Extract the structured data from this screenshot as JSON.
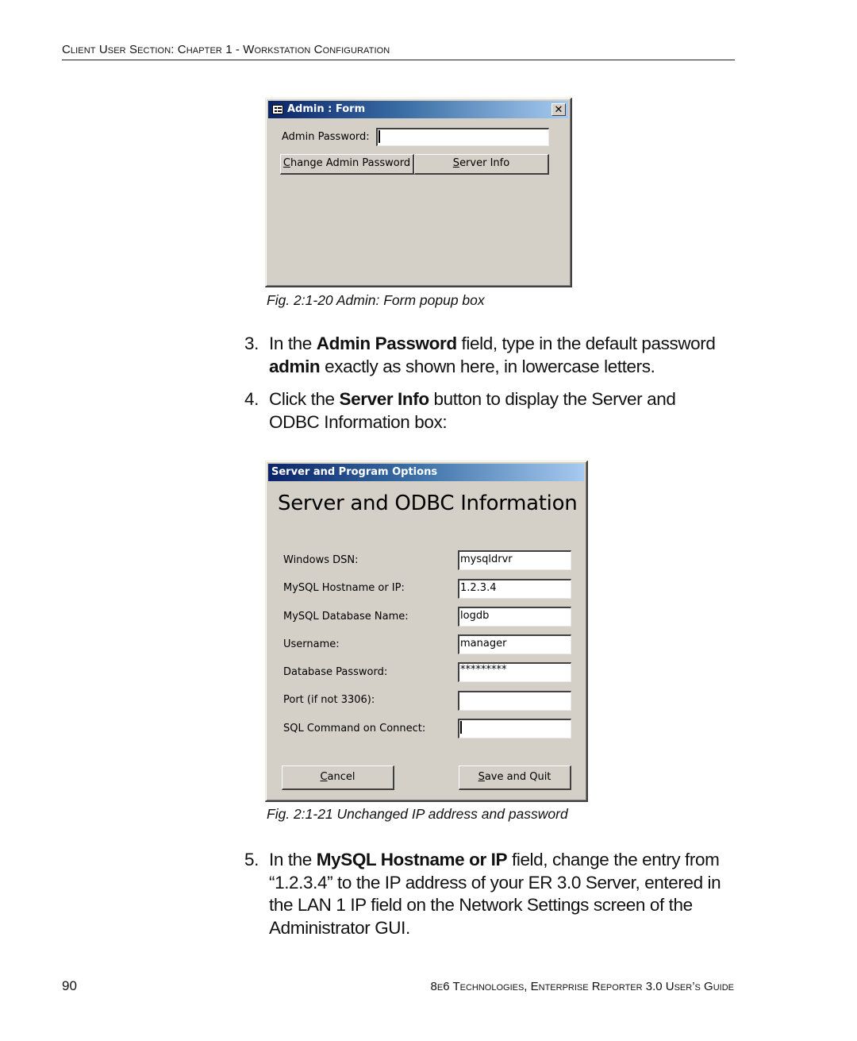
{
  "running_header": "Client User Section: Chapter 1 - Workstation Configuration",
  "admin_form": {
    "title": "Admin : Form",
    "title_icon": "form-icon",
    "close_icon": "close-icon",
    "close_glyph": "✕",
    "password_label": "Admin Password:",
    "password_value": "",
    "change_button": {
      "mnemonic": "C",
      "rest": "hange Admin Password"
    },
    "server_info_button": {
      "mnemonic": "S",
      "rest": "erver Info"
    },
    "caption": "Fig. 2:1-20  Admin: Form popup box"
  },
  "steps_a": [
    {
      "number": "3.",
      "parts": [
        {
          "text": "In the ",
          "bold": false
        },
        {
          "text": "Admin Password",
          "bold": true
        },
        {
          "text": " field, type in the default password ",
          "bold": false
        },
        {
          "text": "admin",
          "bold": true
        },
        {
          "text": " exactly as shown here, in lowercase letters.",
          "bold": false
        }
      ]
    },
    {
      "number": "4.",
      "parts": [
        {
          "text": "Click the ",
          "bold": false
        },
        {
          "text": "Server Info",
          "bold": true
        },
        {
          "text": " button to display the Server and ODBC Information box:",
          "bold": false
        }
      ]
    }
  ],
  "server_dialog": {
    "title": "Server and Program Options",
    "heading": "Server and ODBC Information",
    "fields": [
      {
        "label": "Windows DSN:",
        "value": "mysqldrvr"
      },
      {
        "label": "MySQL Hostname or IP:",
        "value": "1.2.3.4"
      },
      {
        "label": "MySQL Database Name:",
        "value": "logdb"
      },
      {
        "label": "Username:",
        "value": "manager"
      },
      {
        "label": "Database Password:",
        "value": "*********"
      },
      {
        "label": "Port (if not 3306):",
        "value": ""
      },
      {
        "label": "SQL Command on Connect:",
        "value": ""
      }
    ],
    "cancel_button": {
      "mnemonic": "C",
      "rest": "ancel"
    },
    "save_button": {
      "mnemonic": "S",
      "rest": "ave and Quit"
    },
    "caption": "Fig. 2:1-21  Unchanged IP address and password"
  },
  "steps_b": [
    {
      "number": "5.",
      "parts": [
        {
          "text": "In the ",
          "bold": false
        },
        {
          "text": "MySQL Hostname or IP",
          "bold": true
        },
        {
          "text": " field, change the entry from “1.2.3.4” to the IP address of your ER 3.0 Server, entered in the LAN 1 IP field on the Network Settings screen of the Administrator GUI.",
          "bold": false
        }
      ]
    }
  ],
  "footer": {
    "page_number": "90",
    "guide_title": "8e6 Technologies, Enterprise Reporter 3.0 User’s Guide"
  }
}
